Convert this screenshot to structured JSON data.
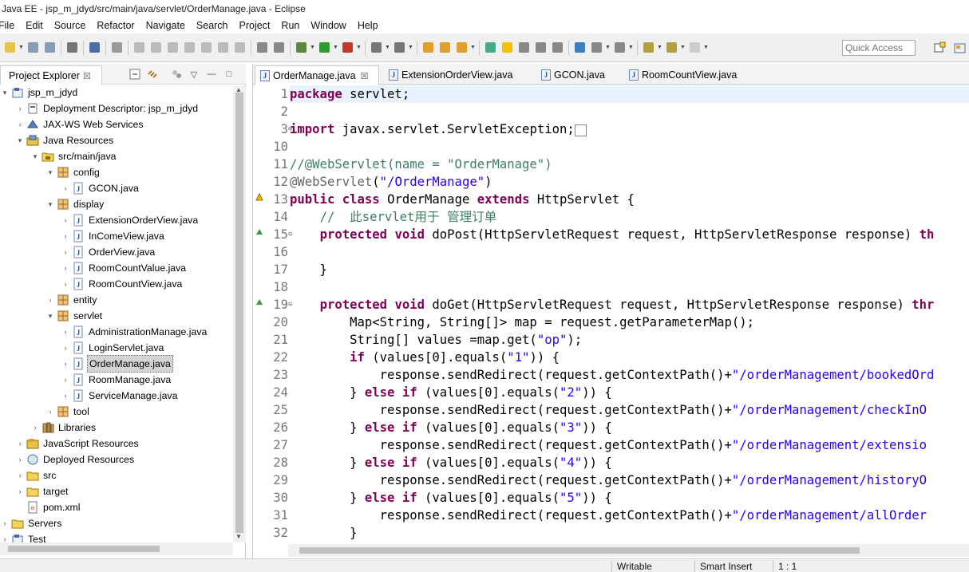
{
  "window": {
    "title": "Java EE - jsp_m_jdyd/src/main/java/servlet/OrderManage.java - Eclipse"
  },
  "menu": [
    "File",
    "Edit",
    "Source",
    "Refactor",
    "Navigate",
    "Search",
    "Project",
    "Run",
    "Window",
    "Help"
  ],
  "toolbar": {
    "quick_access_placeholder": "Quick Access"
  },
  "project_explorer": {
    "tab_label": "Project Explorer",
    "tab_close": "☒",
    "items": [
      {
        "label": "jsp_m_jdyd",
        "icon": "project-icon",
        "arrow": "▾"
      },
      {
        "label": "Deployment Descriptor: jsp_m_jdyd",
        "icon": "deployment-descriptor-icon",
        "arrow": "›"
      },
      {
        "label": "JAX-WS Web Services",
        "icon": "web-services-icon",
        "arrow": "›"
      },
      {
        "label": "Java Resources",
        "icon": "java-resources-icon",
        "arrow": "▾"
      },
      {
        "label": "src/main/java",
        "icon": "source-folder-icon",
        "arrow": "▾"
      },
      {
        "label": "config",
        "icon": "package-icon",
        "arrow": "▾"
      },
      {
        "label": "GCON.java",
        "icon": "java-file-icon",
        "arrow": "›"
      },
      {
        "label": "display",
        "icon": "package-icon",
        "arrow": "▾"
      },
      {
        "label": "ExtensionOrderView.java",
        "icon": "java-file-icon",
        "arrow": "›"
      },
      {
        "label": "InComeView.java",
        "icon": "java-file-icon",
        "arrow": "›"
      },
      {
        "label": "OrderView.java",
        "icon": "java-file-icon",
        "arrow": "›"
      },
      {
        "label": "RoomCountValue.java",
        "icon": "java-file-icon",
        "arrow": "›"
      },
      {
        "label": "RoomCountView.java",
        "icon": "java-file-icon",
        "arrow": "›"
      },
      {
        "label": "entity",
        "icon": "package-icon",
        "arrow": "›"
      },
      {
        "label": "servlet",
        "icon": "package-icon",
        "arrow": "▾"
      },
      {
        "label": "AdministrationManage.java",
        "icon": "java-file-icon",
        "arrow": "›"
      },
      {
        "label": "LoginServlet.java",
        "icon": "java-file-icon",
        "arrow": "›"
      },
      {
        "label": "OrderManage.java",
        "icon": "java-file-icon",
        "arrow": "›",
        "selected": true
      },
      {
        "label": "RoomManage.java",
        "icon": "java-file-icon",
        "arrow": "›"
      },
      {
        "label": "ServiceManage.java",
        "icon": "java-file-icon",
        "arrow": "›"
      },
      {
        "label": "tool",
        "icon": "package-icon",
        "arrow": "›"
      },
      {
        "label": "Libraries",
        "icon": "libraries-icon",
        "arrow": "›"
      },
      {
        "label": "JavaScript Resources",
        "icon": "javascript-resources-icon",
        "arrow": "›"
      },
      {
        "label": "Deployed Resources",
        "icon": "deployed-resources-icon",
        "arrow": "›"
      },
      {
        "label": "src",
        "icon": "folder-icon",
        "arrow": "›"
      },
      {
        "label": "target",
        "icon": "folder-icon",
        "arrow": "›"
      },
      {
        "label": "pom.xml",
        "icon": "xml-file-icon",
        "arrow": ""
      },
      {
        "label": "Servers",
        "icon": "folder-icon",
        "arrow": "›"
      },
      {
        "label": "Test",
        "icon": "project-icon",
        "arrow": "›"
      }
    ]
  },
  "editor": {
    "tabs": [
      {
        "label": "OrderManage.java",
        "active": true,
        "close": "☒"
      },
      {
        "label": "ExtensionOrderView.java"
      },
      {
        "label": "GCON.java"
      },
      {
        "label": "RoomCountView.java"
      }
    ],
    "lines": [
      {
        "n": "1",
        "html": "<span class=\"kw\">package</span> servlet;"
      },
      {
        "n": "2",
        "html": ""
      },
      {
        "n": "3",
        "fold": "⊕",
        "html": "<span class=\"kw\">import</span> javax.servlet.ServletException;<span style=\"border:1px solid #888;font-size:11px;\">&nbsp;&nbsp;</span>"
      },
      {
        "n": "10",
        "html": ""
      },
      {
        "n": "11",
        "html": "<span class=\"cm\">//@WebServlet(name = \"OrderManage\")</span>"
      },
      {
        "n": "12",
        "html": "<span class=\"ann\">@WebServlet</span>(<span class=\"str\">\"/OrderManage\"</span>)"
      },
      {
        "n": "13",
        "marker": "warn",
        "html": "<span class=\"kw\">public</span> <span class=\"kw\">class</span> OrderManage <span class=\"kw\">extends</span> HttpServlet {"
      },
      {
        "n": "14",
        "html": "    <span class=\"cm\">//  此servlet用于 管理订单</span>"
      },
      {
        "n": "15",
        "fold": "⊖",
        "marker": "override",
        "html": "    <span class=\"kw\">protected</span> <span class=\"kw\">void</span> doPost(HttpServletRequest request, HttpServletResponse response) <span class=\"kw\">th</span>"
      },
      {
        "n": "16",
        "html": ""
      },
      {
        "n": "17",
        "html": "    }"
      },
      {
        "n": "18",
        "html": ""
      },
      {
        "n": "19",
        "fold": "⊖",
        "marker": "override",
        "html": "    <span class=\"kw\">protected</span> <span class=\"kw\">void</span> doGet(HttpServletRequest request, HttpServletResponse response) <span class=\"kw\">thr</span>"
      },
      {
        "n": "20",
        "html": "        Map&lt;String, String[]&gt; map = request.getParameterMap();"
      },
      {
        "n": "21",
        "html": "        String[] values =map.get(<span class=\"str\">\"op\"</span>);"
      },
      {
        "n": "22",
        "html": "        <span class=\"kw\">if</span> (values[0].equals(<span class=\"str\">\"1\"</span>)) {"
      },
      {
        "n": "23",
        "html": "            response.sendRedirect(request.getContextPath()+<span class=\"str\">\"/orderManagement/bookedOrd</span>"
      },
      {
        "n": "24",
        "html": "        } <span class=\"kw\">else</span> <span class=\"kw\">if</span> (values[0].equals(<span class=\"str\">\"2\"</span>)) {"
      },
      {
        "n": "25",
        "html": "            response.sendRedirect(request.getContextPath()+<span class=\"str\">\"/orderManagement/checkInO</span>"
      },
      {
        "n": "26",
        "html": "        } <span class=\"kw\">else</span> <span class=\"kw\">if</span> (values[0].equals(<span class=\"str\">\"3\"</span>)) {"
      },
      {
        "n": "27",
        "html": "            response.sendRedirect(request.getContextPath()+<span class=\"str\">\"/orderManagement/extensio</span>"
      },
      {
        "n": "28",
        "html": "        } <span class=\"kw\">else</span> <span class=\"kw\">if</span> (values[0].equals(<span class=\"str\">\"4\"</span>)) {"
      },
      {
        "n": "29",
        "html": "            response.sendRedirect(request.getContextPath()+<span class=\"str\">\"/orderManagement/historyO</span>"
      },
      {
        "n": "30",
        "html": "        } <span class=\"kw\">else</span> <span class=\"kw\">if</span> (values[0].equals(<span class=\"str\">\"5\"</span>)) {"
      },
      {
        "n": "31",
        "html": "            response.sendRedirect(request.getContextPath()+<span class=\"str\">\"/orderManagement/allOrder</span>"
      },
      {
        "n": "32",
        "html": "        }"
      }
    ]
  },
  "status": {
    "writable": "Writable",
    "insert_mode": "Smart Insert",
    "position": "1 : 1"
  },
  "colors": {
    "keyword": "#7f0055",
    "string": "#2a00ff",
    "comment": "#3f7f5f",
    "annotation": "#646464",
    "selection": "#d4d4d4"
  }
}
